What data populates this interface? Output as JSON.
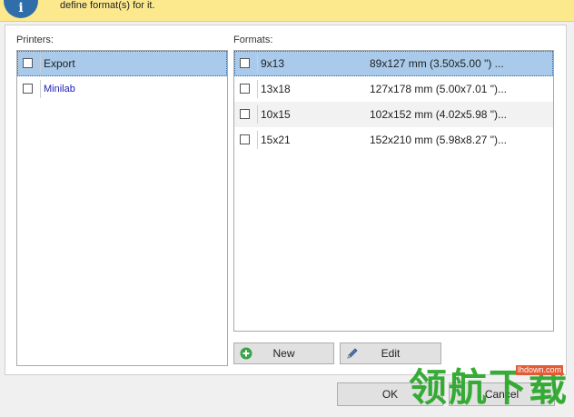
{
  "banner": {
    "text": "define format(s) for it.",
    "icon": "info-icon"
  },
  "printers": {
    "label": "Printers:",
    "items": [
      {
        "name": "Export",
        "selected": true
      },
      {
        "name": "Minilab",
        "selected": false
      }
    ]
  },
  "formats": {
    "label": "Formats:",
    "items": [
      {
        "name": "9x13",
        "size": "89x127 mm (3.50x5.00 \") ...",
        "selected": true
      },
      {
        "name": "13x18",
        "size": "127x178 mm (5.00x7.01 \")...",
        "selected": false
      },
      {
        "name": "10x15",
        "size": "102x152 mm (4.02x5.98 \")...",
        "selected": false
      },
      {
        "name": "15x21",
        "size": "152x210 mm (5.98x8.27 \")...",
        "selected": false
      }
    ]
  },
  "buttons": {
    "new_label": "New",
    "edit_label": "Edit",
    "ok_label": "OK",
    "cancel_label": "Cancel"
  },
  "watermark": {
    "logo_text": "领航下载",
    "url_text": "lhdown.com"
  },
  "colors": {
    "banner_bg": "#fce98e",
    "selection": "#a9caea",
    "new_icon": "#3aa24a",
    "minilab_text": "#1a1ab8"
  }
}
